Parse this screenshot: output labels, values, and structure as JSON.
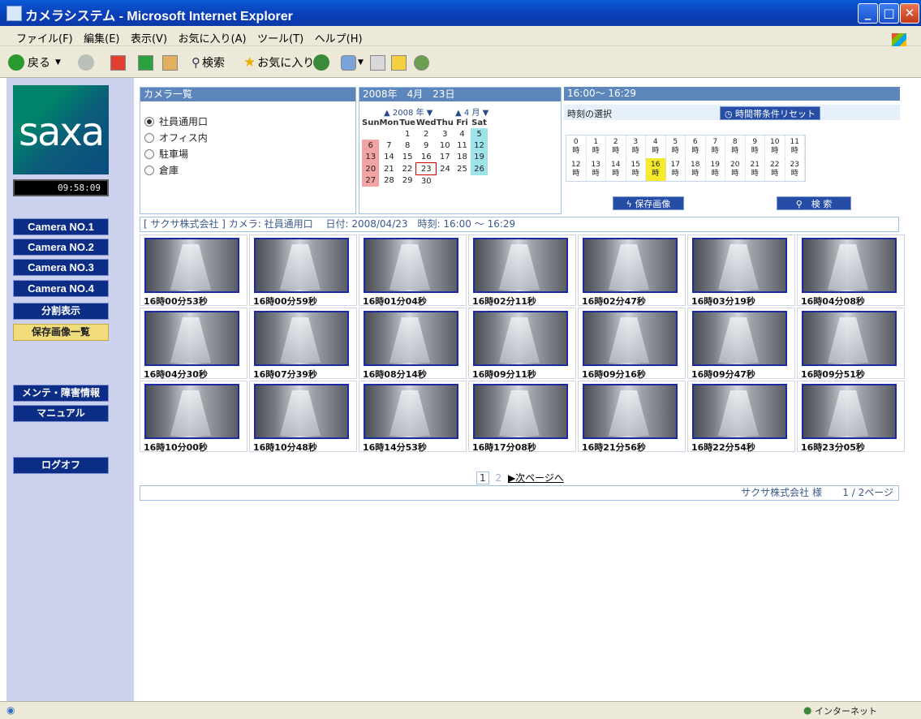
{
  "window": {
    "title": "カメラシステム - Microsoft Internet Explorer"
  },
  "menu": [
    "ファイル(F)",
    "編集(E)",
    "表示(V)",
    "お気に入り(A)",
    "ツール(T)",
    "ヘルプ(H)"
  ],
  "toolbar": {
    "back": "戻る",
    "search": "検索",
    "favorites": "お気に入り"
  },
  "sidebar": {
    "logo": "saxa",
    "clock": "09:58:09",
    "cameras": [
      "Camera NO.1",
      "Camera NO.2",
      "Camera NO.3",
      "Camera NO.4"
    ],
    "split_view": "分割表示",
    "saved_list": "保存画像一覧",
    "maintenance": "メンテ・障害情報",
    "manual": "マニュアル",
    "logoff": "ログオフ"
  },
  "camera_panel": {
    "header": "カメラ一覧",
    "items": [
      "社員通用口",
      "オフィス内",
      "駐車場",
      "倉庫"
    ]
  },
  "calendar": {
    "header": "2008年　4月　23日",
    "year_label": "▲ 2008 年 ▼",
    "month_label": "▲ 4 月 ▼",
    "days": [
      "Sun",
      "Mon",
      "Tue",
      "Wed",
      "Thu",
      "Fri",
      "Sat"
    ],
    "weeks": [
      [
        "",
        "",
        "1",
        "2",
        "3",
        "4",
        "5"
      ],
      [
        "6",
        "7",
        "8",
        "9",
        "10",
        "11",
        "12"
      ],
      [
        "13",
        "14",
        "15",
        "16",
        "17",
        "18",
        "19"
      ],
      [
        "20",
        "21",
        "22",
        "23",
        "24",
        "25",
        "26"
      ],
      [
        "27",
        "28",
        "29",
        "30",
        "",
        "",
        ""
      ]
    ]
  },
  "time_panel": {
    "header": "16:00～ 16:29",
    "subtitle": "時刻の選択",
    "reset": "時間帯条件リセット",
    "hours": [
      "0",
      "1",
      "2",
      "3",
      "4",
      "5",
      "6",
      "7",
      "8",
      "9",
      "10",
      "11",
      "12",
      "13",
      "14",
      "15",
      "16",
      "17",
      "18",
      "19",
      "20",
      "21",
      "22",
      "23"
    ],
    "hour_unit": "時",
    "selected_hour": "16",
    "save_btn": "保存画像",
    "search_btn": "検 索"
  },
  "info": "[ サクサ株式会社 ] カメラ: 社員通用口　 日付: 2008/04/23　時刻: 16:00 ～ 16:29",
  "thumbnails": [
    "16時00分53秒",
    "16時00分59秒",
    "16時01分04秒",
    "16時02分11秒",
    "16時02分47秒",
    "16時03分19秒",
    "16時04分08秒",
    "16時04分30秒",
    "16時07分39秒",
    "16時08分14秒",
    "16時09分11秒",
    "16時09分16秒",
    "16時09分47秒",
    "16時09分51秒",
    "16時10分00秒",
    "16時10分48秒",
    "16時14分53秒",
    "16時17分08秒",
    "16時21分56秒",
    "16時22分54秒",
    "16時23分05秒"
  ],
  "pager": {
    "current": "1",
    "next_page": "2",
    "next": "▶次ページへ"
  },
  "footer": {
    "company": "サクサ株式会社 様",
    "pages": "1 / 2ページ"
  },
  "status": {
    "zone": "インターネット"
  }
}
